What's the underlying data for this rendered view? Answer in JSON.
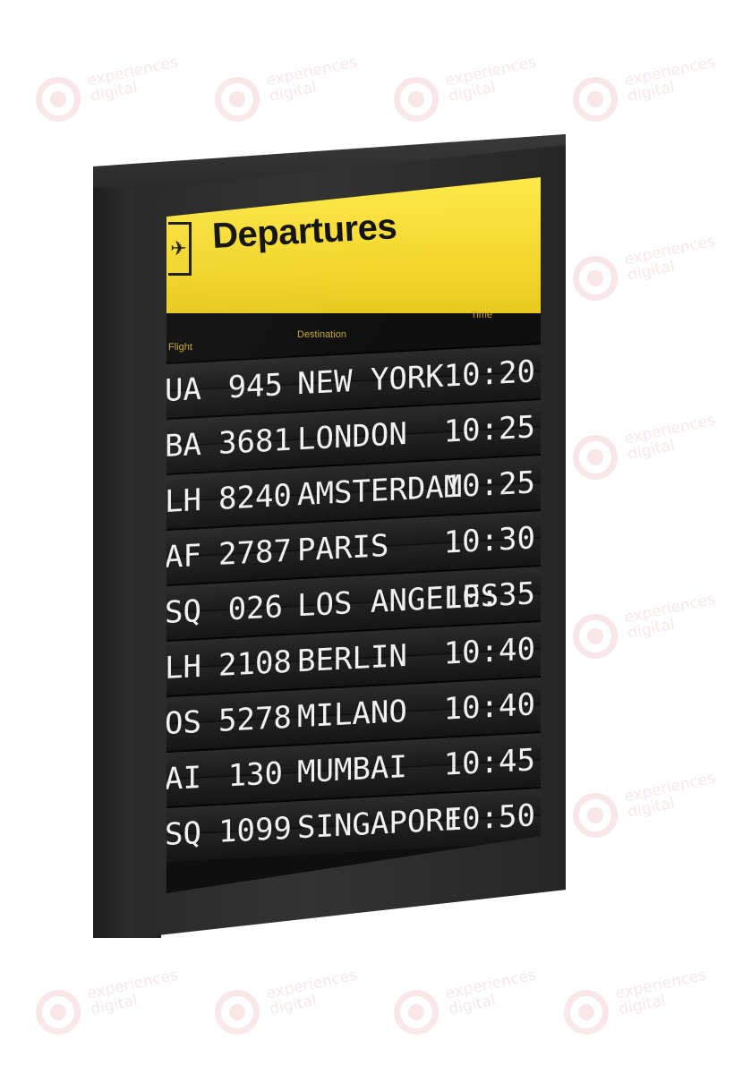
{
  "watermark": {
    "line1": "experiences",
    "line2": "digital"
  },
  "board": {
    "title": "Departures",
    "icon": "plane-icon",
    "headers": {
      "flight": "Flight",
      "destination": "Destination",
      "time": "Time"
    },
    "rows": [
      {
        "airline": "UA",
        "number": "945",
        "destination": "NEW YORK",
        "time": "10:20"
      },
      {
        "airline": "BA",
        "number": "3681",
        "destination": "LONDON",
        "time": "10:25"
      },
      {
        "airline": "LH",
        "number": "8240",
        "destination": "AMSTERDAM",
        "time": "10:25"
      },
      {
        "airline": "AF",
        "number": "2787",
        "destination": "PARIS",
        "time": "10:30"
      },
      {
        "airline": "SQ",
        "number": "026",
        "destination": "LOS ANGELES",
        "time": "10:35"
      },
      {
        "airline": "LH",
        "number": "2108",
        "destination": "BERLIN",
        "time": "10:40"
      },
      {
        "airline": "OS",
        "number": "5278",
        "destination": "MILANO",
        "time": "10:40"
      },
      {
        "airline": "AI",
        "number": "130",
        "destination": "MUMBAI",
        "time": "10:45"
      },
      {
        "airline": "SQ",
        "number": "1099",
        "destination": "SINGAPORE",
        "time": "10:50"
      }
    ]
  },
  "colors": {
    "header_yellow": "#f2d52a",
    "frame": "#2a2a2a",
    "watermark": "#c8242b"
  }
}
